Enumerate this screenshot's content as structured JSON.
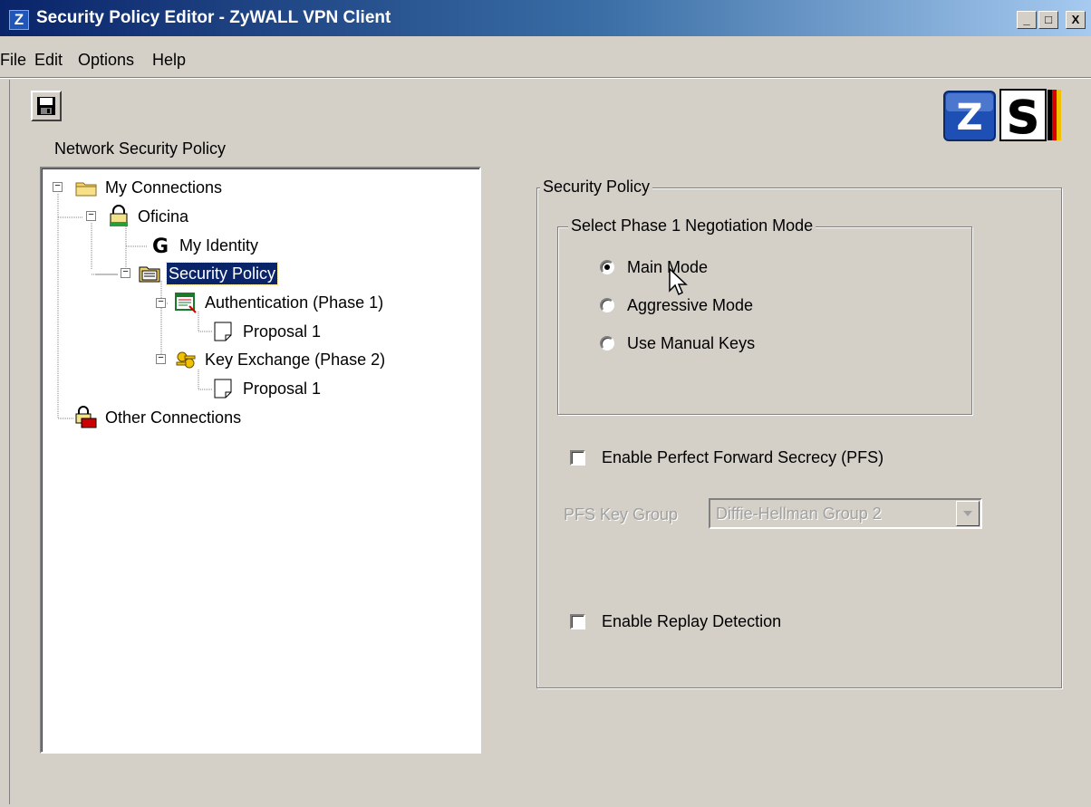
{
  "window": {
    "title": "Security Policy Editor - ZyWALL VPN Client",
    "app_icon_letter": "Z",
    "controls": {
      "minimize": "_",
      "maximize": "□",
      "close": "X"
    }
  },
  "menu": [
    "File",
    "Edit",
    "Options",
    "Help"
  ],
  "toolbar": {
    "save_icon": "floppy-disk-icon"
  },
  "logo": {
    "letters": [
      "Z",
      "S"
    ]
  },
  "tree": {
    "label": "Network Security Policy",
    "nodes": [
      {
        "label": "My Connections",
        "icon": "folder-icon",
        "expanded": true
      },
      {
        "label": "Oficina",
        "icon": "connection-lock-icon",
        "expanded": true
      },
      {
        "label": "My Identity",
        "icon": "identity-icon"
      },
      {
        "label": "Security Policy",
        "icon": "security-policy-icon",
        "expanded": true,
        "selected": true
      },
      {
        "label": "Authentication (Phase 1)",
        "icon": "authentication-icon",
        "expanded": true
      },
      {
        "label": "Proposal 1",
        "icon": "proposal-icon"
      },
      {
        "label": "Key Exchange (Phase 2)",
        "icon": "key-exchange-icon",
        "expanded": true
      },
      {
        "label": "Proposal 1",
        "icon": "proposal-icon"
      },
      {
        "label": "Other Connections",
        "icon": "other-connections-icon"
      }
    ]
  },
  "security_policy": {
    "legend": "Security Policy",
    "phase1": {
      "legend": "Select Phase 1 Negotiation Mode",
      "options": [
        {
          "label": "Main Mode",
          "checked": true
        },
        {
          "label": "Aggressive Mode",
          "checked": false
        },
        {
          "label": "Use Manual Keys",
          "checked": false
        }
      ]
    },
    "pfs": {
      "label": "Enable Perfect Forward Secrecy (PFS)",
      "checked": false
    },
    "pfs_key_group": {
      "label": "PFS Key Group",
      "value": "Diffie-Hellman Group 2",
      "disabled": true
    },
    "replay": {
      "label": "Enable Replay Detection",
      "checked": false
    }
  },
  "colors": {
    "window_bg": "#d4d0c8",
    "titlebar_start": "#0a246a",
    "titlebar_end": "#a6caf0",
    "selection": "#0a246a",
    "disabled_text": "#a0a0a0"
  }
}
